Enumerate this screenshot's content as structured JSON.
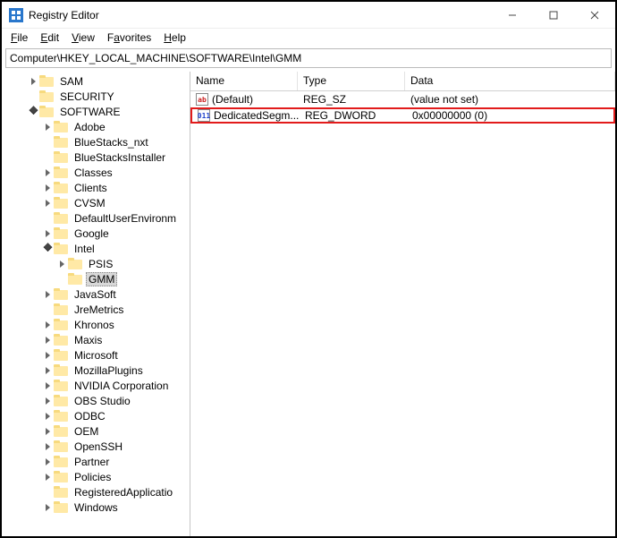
{
  "window": {
    "title": "Registry Editor"
  },
  "menu": {
    "file": "File",
    "edit": "Edit",
    "view": "View",
    "favorites": "Favorites",
    "help": "Help"
  },
  "addressbar": {
    "path": "Computer\\HKEY_LOCAL_MACHINE\\SOFTWARE\\Intel\\GMM"
  },
  "tree": {
    "n0": "SAM",
    "n1": "SECURITY",
    "n2": "SOFTWARE",
    "n3": "Adobe",
    "n4": "BlueStacks_nxt",
    "n5": "BlueStacksInstaller",
    "n6": "Classes",
    "n7": "Clients",
    "n8": "CVSM",
    "n9": "DefaultUserEnvironm",
    "n10": "Google",
    "n11": "Intel",
    "n12": "PSIS",
    "n13": "GMM",
    "n14": "JavaSoft",
    "n15": "JreMetrics",
    "n16": "Khronos",
    "n17": "Maxis",
    "n18": "Microsoft",
    "n19": "MozillaPlugins",
    "n20": "NVIDIA Corporation",
    "n21": "OBS Studio",
    "n22": "ODBC",
    "n23": "OEM",
    "n24": "OpenSSH",
    "n25": "Partner",
    "n26": "Policies",
    "n27": "RegisteredApplicatio",
    "n28": "Windows"
  },
  "list": {
    "cols": {
      "name": "Name",
      "type": "Type",
      "data": "Data"
    },
    "rows": [
      {
        "icon": "ab",
        "name": "(Default)",
        "type": "REG_SZ",
        "data": "(value not set)"
      },
      {
        "icon": "011",
        "name": "DedicatedSegm...",
        "type": "REG_DWORD",
        "data": "0x00000000 (0)"
      }
    ]
  }
}
